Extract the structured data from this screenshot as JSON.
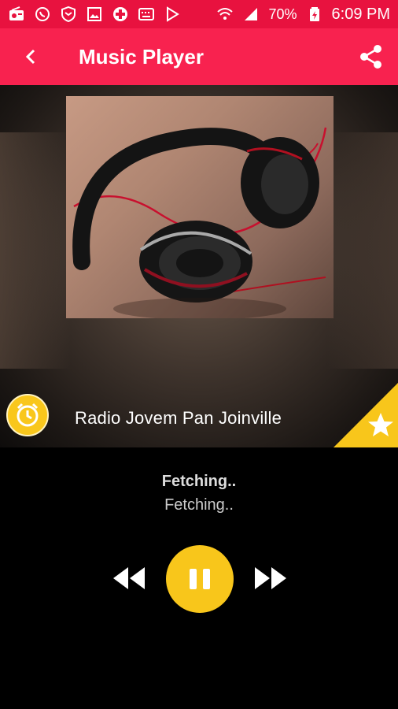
{
  "status_bar": {
    "battery_percent": "70%",
    "time": "6:09 PM",
    "icons_left": [
      "radio-icon",
      "whatsapp-icon",
      "shield-icon",
      "image-icon",
      "plus-circle-icon",
      "keyboard-icon",
      "play-store-icon"
    ],
    "icons_right": [
      "wifi-icon",
      "signal-icon",
      "battery-icon"
    ]
  },
  "app_bar": {
    "title": "Music Player",
    "back_icon": "chevron-left-icon",
    "share_icon": "share-icon"
  },
  "player": {
    "station_name": "Radio Jovem Pan Joinville",
    "track_title": "Fetching..",
    "track_artist": "Fetching..",
    "state": "playing"
  },
  "colors": {
    "status_bar": "#e8123f",
    "app_bar": "#f8224f",
    "accent": "#f8c61b",
    "background": "#000000"
  }
}
